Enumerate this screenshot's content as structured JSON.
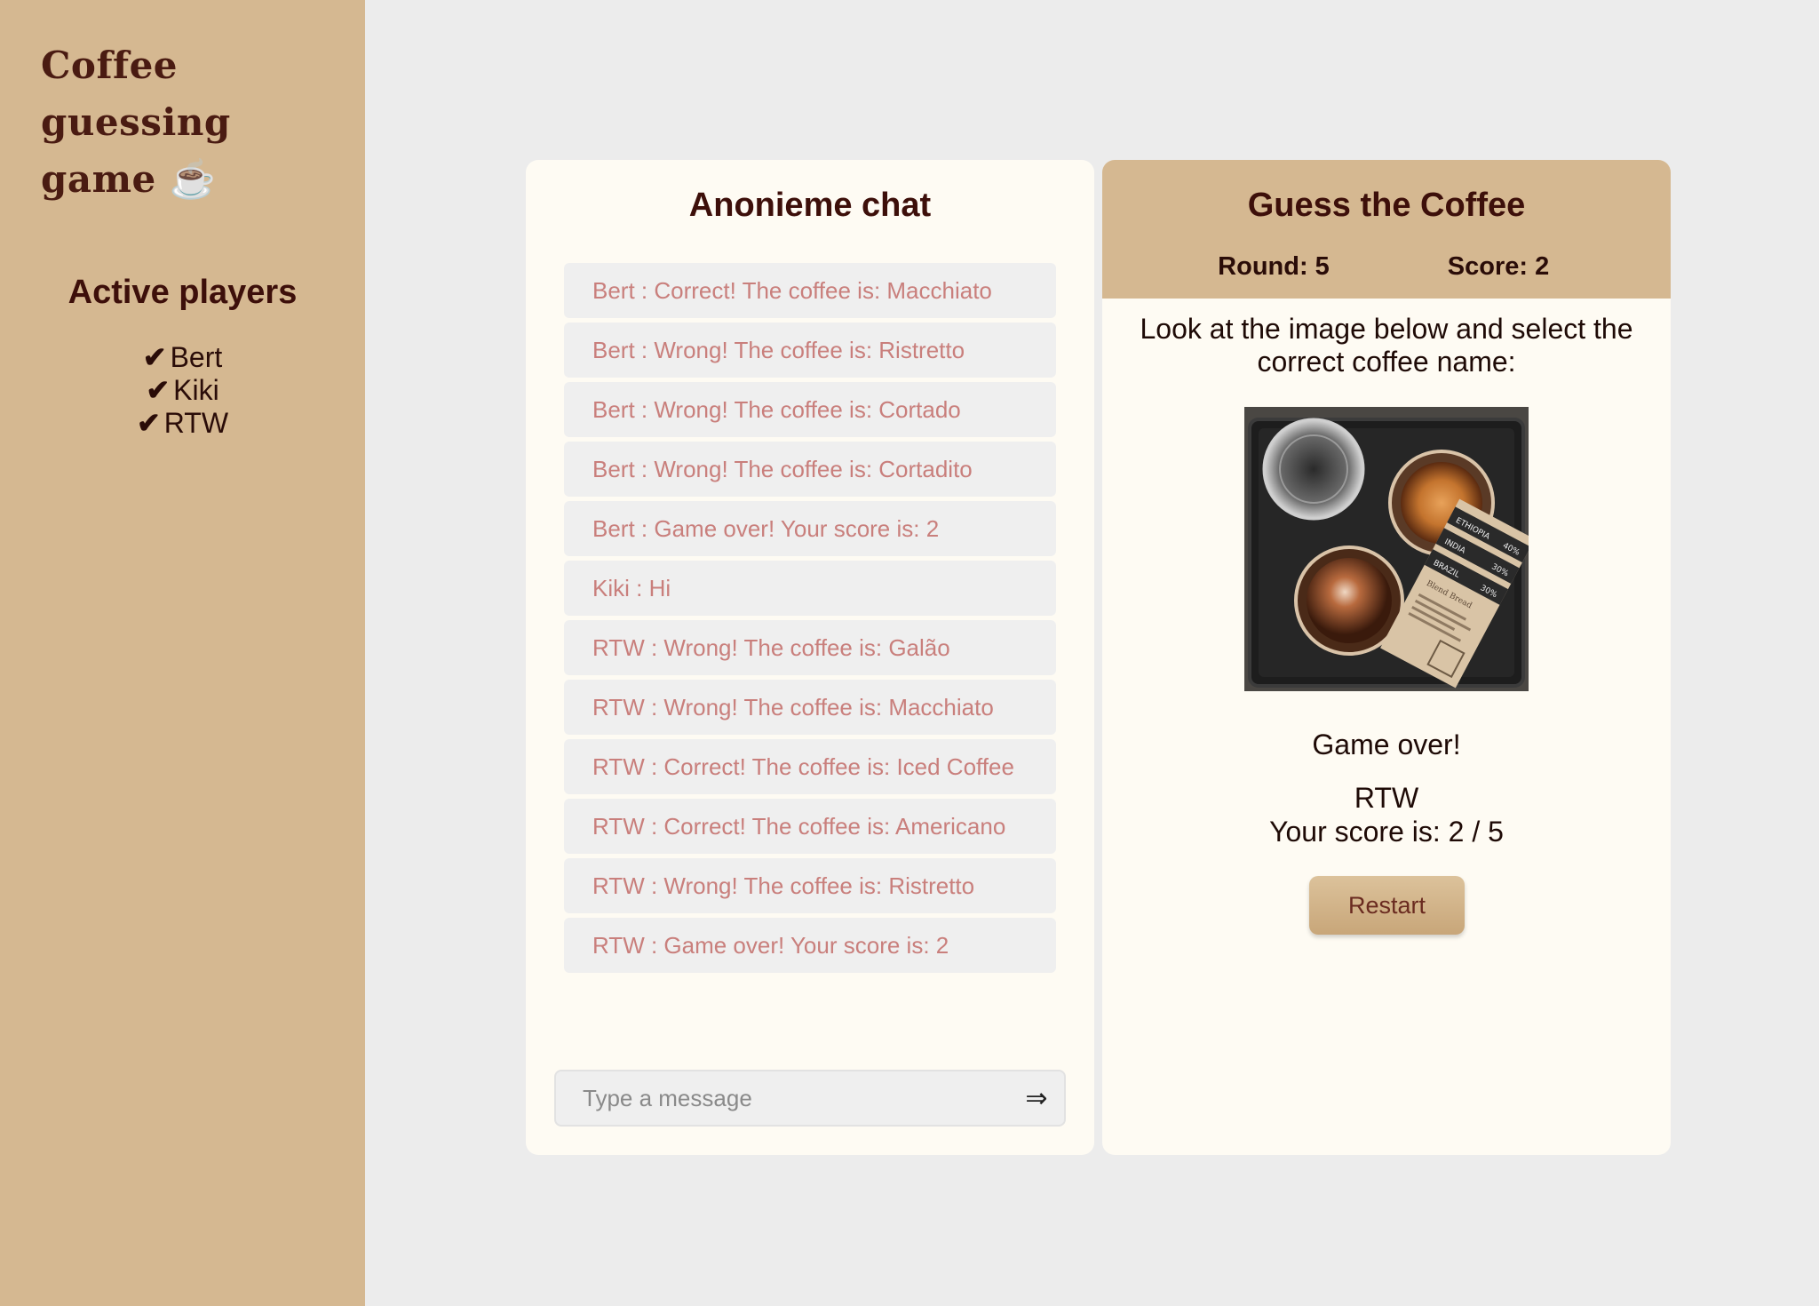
{
  "sidebar": {
    "app_title": "Coffee guessing game ☕",
    "players_title": "Active players",
    "check_symbol": "✔",
    "players": [
      "Bert",
      "Kiki",
      "RTW"
    ]
  },
  "chat": {
    "title": "Anonieme chat",
    "messages": [
      "Bert : Correct! The coffee is: Macchiato",
      "Bert : Wrong! The coffee is: Ristretto",
      "Bert : Wrong! The coffee is: Cortado",
      "Bert : Wrong! The coffee is: Cortadito",
      "Bert : Game over! Your score is: 2",
      "Kiki : Hi",
      "RTW : Wrong! The coffee is: Galão",
      "RTW : Wrong! The coffee is: Macchiato",
      "RTW : Correct! The coffee is: Iced Coffee",
      "RTW : Correct! The coffee is: Americano",
      "RTW : Wrong! The coffee is: Ristretto",
      "RTW : Game over! Your score is: 2"
    ],
    "input_placeholder": "Type a message",
    "send_icon": "⇒"
  },
  "game": {
    "title": "Guess the Coffee",
    "round_label": "Round: 5",
    "score_label": "Score: 2",
    "instructions": "Look at the image below and select the correct coffee name:",
    "image_label": {
      "line1": "ETHIOPIA",
      "line1_pct": "40%",
      "line2": "INDIA",
      "line3": "BRAZIL",
      "line3_pct": "30%",
      "line4_pct": "30%",
      "line5": "Blend Bread"
    },
    "game_over": "Game over!",
    "player_name": "RTW",
    "final_score": "Your score is: 2 / 5",
    "restart_label": "Restart"
  },
  "colors": {
    "sidebar_bg": "#d5b891",
    "panel_bg": "#fefbf3",
    "page_bg": "#ececec",
    "heading": "#3d0f0a",
    "message_text": "#c97f7c"
  }
}
